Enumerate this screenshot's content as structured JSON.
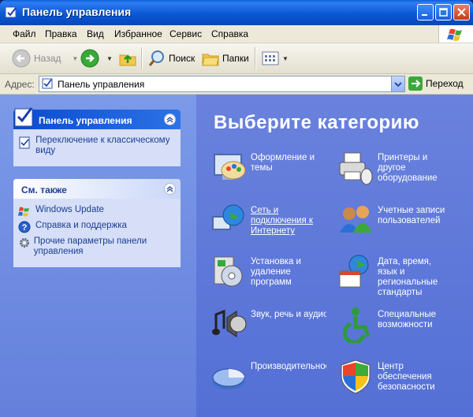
{
  "window": {
    "title": "Панель управления"
  },
  "menu": [
    "Файл",
    "Правка",
    "Вид",
    "Избранное",
    "Сервис",
    "Справка"
  ],
  "toolbar": {
    "back": "Назад",
    "search": "Поиск",
    "folders": "Папки"
  },
  "address": {
    "label": "Адрес:",
    "value": "Панель управления",
    "go": "Переход"
  },
  "left": {
    "cp_panel": {
      "title": "Панель управления",
      "switch_link": "Переключение к классическому виду"
    },
    "see_also": {
      "title": "См. также",
      "items": [
        "Windows Update",
        "Справка и поддержка",
        "Прочие параметры панели управления"
      ]
    }
  },
  "main": {
    "heading": "Выберите категорию",
    "categories": [
      {
        "label": "Оформление и темы",
        "icon": "appearance-icon"
      },
      {
        "label": "Принтеры и другое оборудование",
        "icon": "printer-icon"
      },
      {
        "label": "Сеть и подключения к Интернету",
        "icon": "network-icon"
      },
      {
        "label": "Учетные записи пользователей",
        "icon": "users-icon"
      },
      {
        "label": "Установка и удаление программ",
        "icon": "add-remove-icon"
      },
      {
        "label": "Дата, время, язык и региональные стандарты",
        "icon": "datetime-icon"
      },
      {
        "label": "Звук, речь и аудиоустройства",
        "icon": "sound-icon"
      },
      {
        "label": "Специальные возможности",
        "icon": "accessibility-icon"
      },
      {
        "label": "Производительность и",
        "icon": "performance-icon"
      },
      {
        "label": "Центр обеспечения безопасности",
        "icon": "security-icon"
      }
    ]
  }
}
